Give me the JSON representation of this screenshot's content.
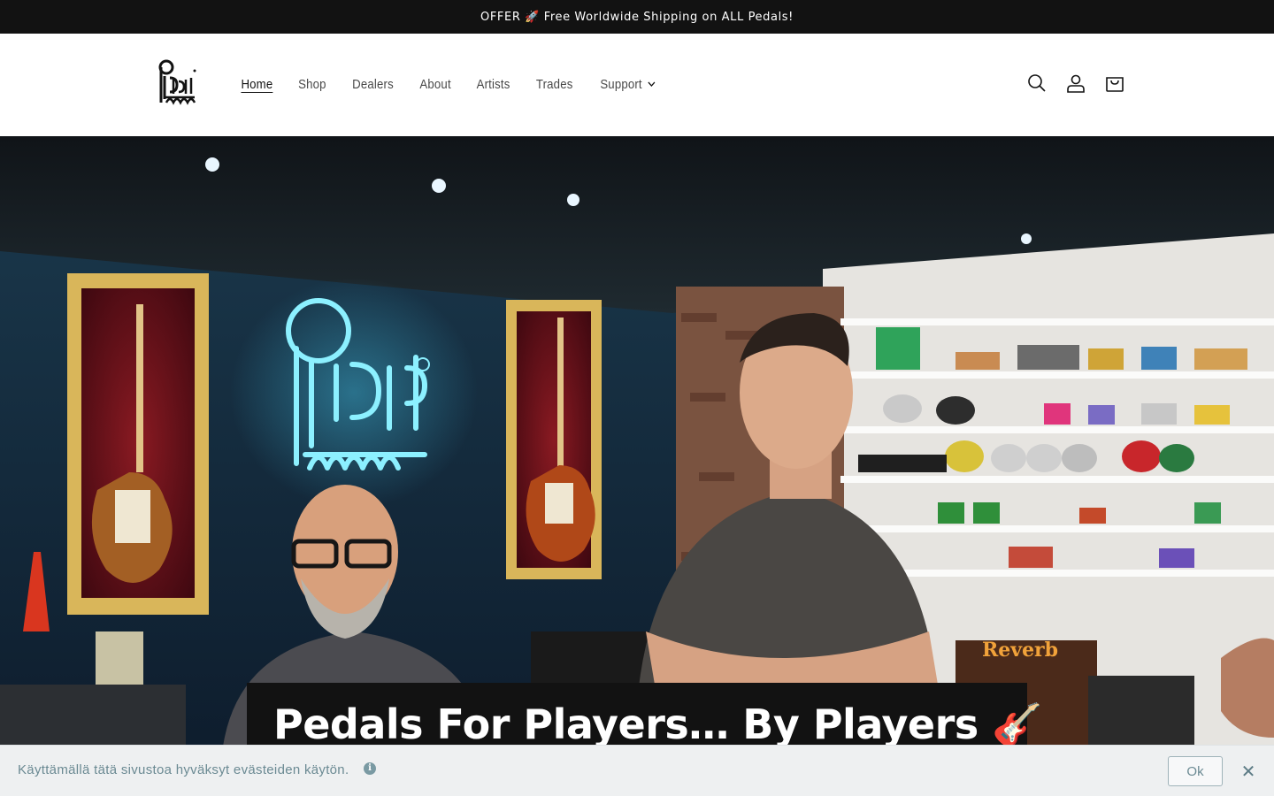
{
  "announcement": {
    "text": "OFFER 🚀 Free Worldwide Shipping on ALL Pedals!"
  },
  "header": {
    "logo": {
      "alt": "Pedal Pawn",
      "icon": "pedal-pawn-logo"
    },
    "nav": [
      {
        "label": "Home",
        "active": true
      },
      {
        "label": "Shop"
      },
      {
        "label": "Dealers"
      },
      {
        "label": "About"
      },
      {
        "label": "Artists"
      },
      {
        "label": "Trades"
      },
      {
        "label": "Support",
        "has_dropdown": true
      }
    ],
    "icons": [
      "search-icon",
      "account-icon",
      "cart-icon"
    ]
  },
  "hero": {
    "title": "Pedals For Players… By Players 🎸",
    "neon_sign": "Pedal Pawn",
    "shelf_sign": "Reverb"
  },
  "cookie_banner": {
    "text": "Käyttämällä tätä sivustoa hyväksyt evästeiden käytön.",
    "info_icon": "i",
    "ok_label": "Ok",
    "close_label": "✕"
  },
  "colors": {
    "announcement_bg": "#121212",
    "neon": "#7fe6ff",
    "cookie_bg": "#eef0f1",
    "cookie_text": "#6b8a93"
  }
}
